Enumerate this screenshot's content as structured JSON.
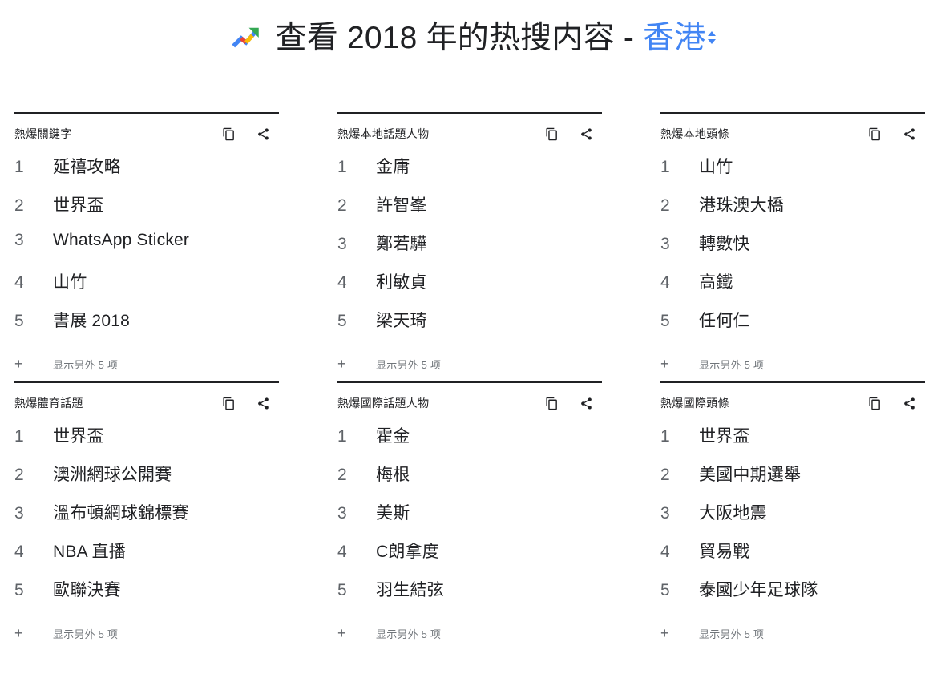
{
  "header": {
    "icon": "trending-up-icon",
    "title_prefix": "查看 2018 年的热搜内容 - ",
    "region": "香港",
    "region_selector_icon": "chevron-up-down-icon"
  },
  "card_icons": {
    "copy": "copy-icon",
    "share": "share-icon",
    "plus": "plus-icon"
  },
  "show_more_label": "显示另外 5 项",
  "cards": [
    {
      "title": "熱爆關鍵字",
      "items": [
        {
          "rank": "1",
          "text": "延禧攻略"
        },
        {
          "rank": "2",
          "text": "世界盃"
        },
        {
          "rank": "3",
          "text": "WhatsApp Sticker"
        },
        {
          "rank": "4",
          "text": "山竹"
        },
        {
          "rank": "5",
          "text": "書展 2018"
        }
      ],
      "show_more": "显示另外 5 项"
    },
    {
      "title": "熱爆本地話題人物",
      "items": [
        {
          "rank": "1",
          "text": "金庸"
        },
        {
          "rank": "2",
          "text": "許智峯"
        },
        {
          "rank": "3",
          "text": "鄭若驊"
        },
        {
          "rank": "4",
          "text": "利敏貞"
        },
        {
          "rank": "5",
          "text": "梁天琦"
        }
      ],
      "show_more": "显示另外 5 项"
    },
    {
      "title": "熱爆本地頭條",
      "items": [
        {
          "rank": "1",
          "text": "山竹"
        },
        {
          "rank": "2",
          "text": "港珠澳大橋"
        },
        {
          "rank": "3",
          "text": "轉數快"
        },
        {
          "rank": "4",
          "text": "高鐵"
        },
        {
          "rank": "5",
          "text": "任何仁"
        }
      ],
      "show_more": "显示另外 5 项"
    },
    {
      "title": "熱爆體育話題",
      "items": [
        {
          "rank": "1",
          "text": "世界盃"
        },
        {
          "rank": "2",
          "text": "澳洲網球公開賽"
        },
        {
          "rank": "3",
          "text": "溫布頓網球錦標賽"
        },
        {
          "rank": "4",
          "text": "NBA 直播"
        },
        {
          "rank": "5",
          "text": "歐聯決賽"
        }
      ],
      "show_more": "显示另外 5 项"
    },
    {
      "title": "熱爆國際話題人物",
      "items": [
        {
          "rank": "1",
          "text": "霍金"
        },
        {
          "rank": "2",
          "text": "梅根"
        },
        {
          "rank": "3",
          "text": "美斯"
        },
        {
          "rank": "4",
          "text": "C朗拿度"
        },
        {
          "rank": "5",
          "text": "羽生結弦"
        }
      ],
      "show_more": "显示另外 5 项"
    },
    {
      "title": "熱爆國際頭條",
      "items": [
        {
          "rank": "1",
          "text": "世界盃"
        },
        {
          "rank": "2",
          "text": "美國中期選舉"
        },
        {
          "rank": "3",
          "text": "大阪地震"
        },
        {
          "rank": "4",
          "text": "貿易戰"
        },
        {
          "rank": "5",
          "text": "泰國少年足球隊"
        }
      ],
      "show_more": "显示另外 5 项"
    }
  ],
  "colors": {
    "accent_blue": "#4285f4",
    "text_primary": "#202124",
    "text_secondary": "#5f6368",
    "text_muted": "#70757a",
    "rule": "#202124",
    "google_blue": "#4285f4",
    "google_red": "#ea4335",
    "google_yellow": "#fbbc04",
    "google_green": "#34a853"
  }
}
